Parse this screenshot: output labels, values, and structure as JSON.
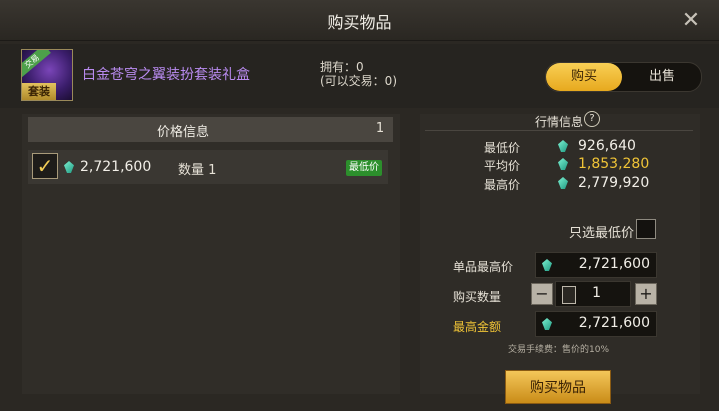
{
  "window": {
    "title": "购买物品"
  },
  "item": {
    "name": "白金苍穹之翼装扮套装礼盒",
    "icon_ribbon": "交易",
    "icon_tag": "套装",
    "owned_line": "拥有：0",
    "tradable_line": "(可以交易：0)"
  },
  "mode_toggle": {
    "buy_label": "购买",
    "sell_label": "出售",
    "selected": "buy"
  },
  "price_info": {
    "header_label": "价格信息",
    "count": "1",
    "listings": [
      {
        "price": "2,721,600",
        "quantity": "数量 1",
        "badge": "最低价",
        "checked": true
      }
    ]
  },
  "market_info": {
    "title": "行情信息",
    "lowest_label": "最低价",
    "lowest_value": "926,640",
    "average_label": "平均价",
    "average_value": "1,853,280",
    "highest_label": "最高价",
    "highest_value": "2,779,920"
  },
  "order_form": {
    "lowest_only_label": "只选最低价",
    "lowest_only_checked": false,
    "max_unit_price_label": "单品最高价",
    "max_unit_price_value": "2,721,600",
    "quantity_label": "购买数量",
    "quantity_value": "1",
    "max_total_label": "最高金额",
    "max_total_value": "2,721,600",
    "fee_note": "交易手续费：售价的10%",
    "submit_label": "购买物品"
  },
  "colors": {
    "accent_gold": "#f0c437",
    "item_purple": "#b98bf0",
    "badge_green": "#2c8f2c"
  }
}
